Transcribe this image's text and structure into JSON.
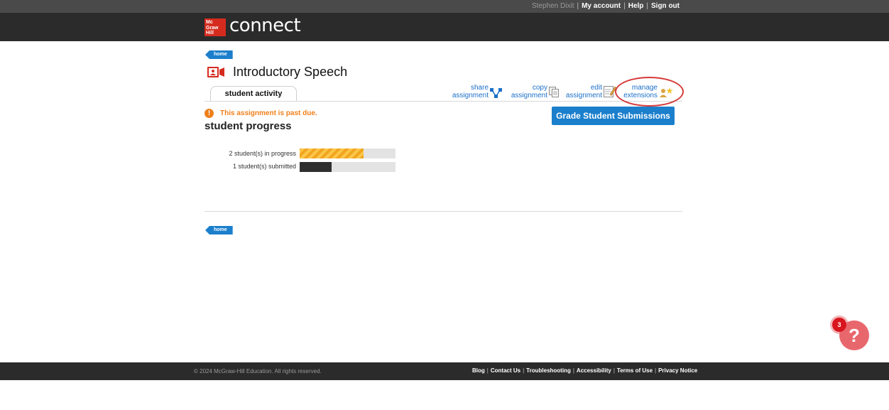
{
  "top_bar": {
    "user_name": "Stephen Dixit",
    "links": [
      "My account",
      "Help",
      "Sign out"
    ]
  },
  "brand": {
    "logo_lines": [
      "Mc",
      "Graw",
      "Hill"
    ],
    "product": "connect"
  },
  "breadcrumb": {
    "home": "home"
  },
  "assignment": {
    "title": "Introductory Speech",
    "icon": "video-camera-icon"
  },
  "tabs": [
    {
      "label": "student activity",
      "active": true
    }
  ],
  "actions": {
    "share": "share\nassignment",
    "copy": "copy\nassignment",
    "edit": "edit\nassignment",
    "manage": "manage\nextensions"
  },
  "grade_button": "Grade Student Submissions",
  "warning": "This assignment is past due.",
  "progress": {
    "title": "student progress",
    "rows": [
      {
        "label": "2 student(s) in progress",
        "fraction": 0.67,
        "style": "striped"
      },
      {
        "label": "1 student(s) submitted",
        "fraction": 0.33,
        "style": "dark"
      }
    ]
  },
  "help": {
    "count": "3",
    "symbol": "?"
  },
  "footer": {
    "copyright": "© 2024 McGraw-Hill Education. All rights reserved.",
    "links": [
      "Blog",
      "Contact Us",
      "Troubleshooting",
      "Accessibility",
      "Terms of Use",
      "Privacy Notice"
    ]
  },
  "colors": {
    "accent_blue": "#1b7fcc",
    "warning_orange": "#f07f1a",
    "brand_red": "#d52b1e",
    "highlight_red": "#d63a3a"
  }
}
